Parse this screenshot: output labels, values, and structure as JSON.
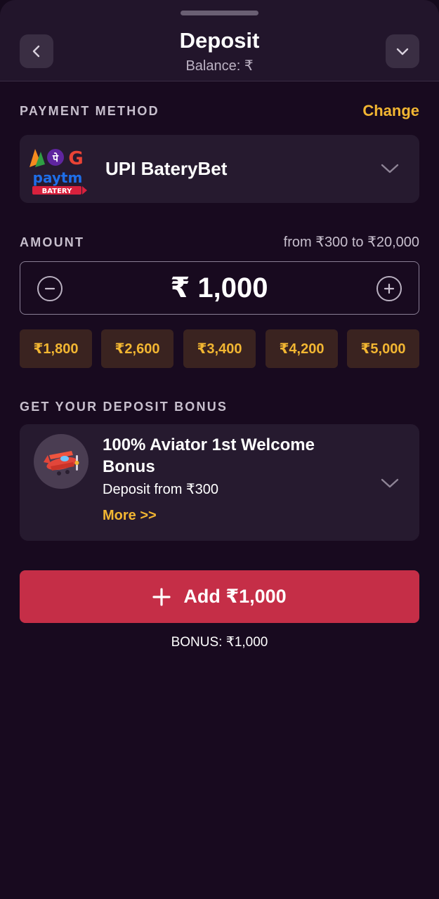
{
  "header": {
    "title": "Deposit",
    "balance": "Balance: ₹",
    "back_icon": "chevron-left-icon",
    "close_icon": "chevron-down-icon"
  },
  "payment": {
    "section_label": "PAYMENT METHOD",
    "change_label": "Change",
    "method_name": "UPI BateryBet",
    "logo": {
      "phonepe_glyph": "पे",
      "google_glyph": "G",
      "paytm_text": "paytm",
      "batery_text": "BATERY"
    }
  },
  "amount": {
    "section_label": "AMOUNT",
    "range": "from ₹300 to ₹20,000",
    "value": "₹ 1,000",
    "presets": [
      "₹1,800",
      "₹2,600",
      "₹3,400",
      "₹4,200",
      "₹5,000"
    ]
  },
  "bonus": {
    "section_label": "GET YOUR DEPOSIT BONUS",
    "title": "100% Aviator 1st Welcome Bonus",
    "subtitle": "Deposit from ₹300",
    "more": "More >>",
    "icon": "airplane-icon"
  },
  "action": {
    "add_label": "Add ₹1,000",
    "bonus_note": "BONUS: ₹1,000"
  },
  "colors": {
    "accent_gold": "#f2b632",
    "cta_red": "#c52e47",
    "background": "#180a1f",
    "card": "#261a2f"
  }
}
